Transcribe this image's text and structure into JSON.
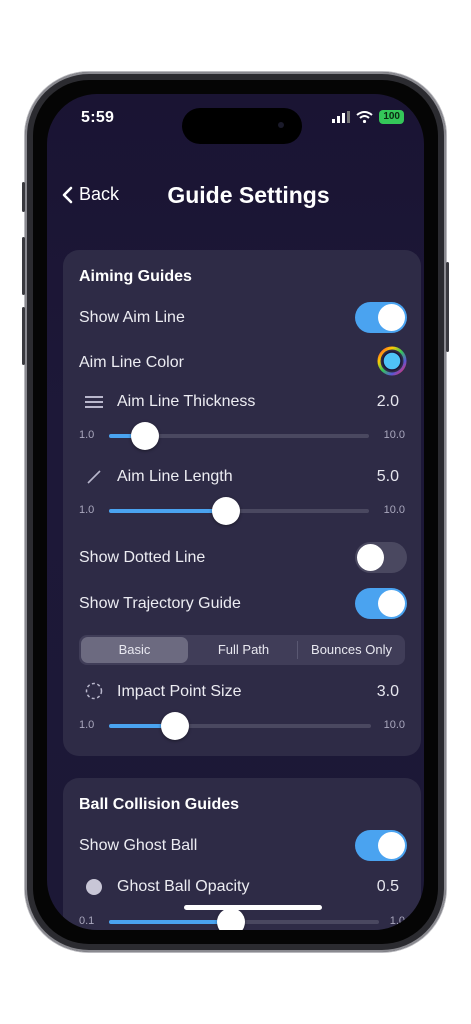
{
  "status": {
    "time": "5:59",
    "battery": "100"
  },
  "nav": {
    "back_label": "Back",
    "title": "Guide Settings"
  },
  "aiming": {
    "title": "Aiming Guides",
    "show_aim_line": {
      "label": "Show Aim Line",
      "on": true
    },
    "aim_line_color": {
      "label": "Aim Line Color",
      "swatch": "#4fc3f7"
    },
    "thickness": {
      "label": "Aim Line Thickness",
      "value": "2.0",
      "min": "1.0",
      "max": "10.0",
      "fraction": 0.14
    },
    "length": {
      "label": "Aim Line Length",
      "value": "5.0",
      "min": "1.0",
      "max": "10.0",
      "fraction": 0.45
    },
    "show_dotted_line": {
      "label": "Show Dotted Line",
      "on": false
    },
    "show_trajectory": {
      "label": "Show Trajectory Guide",
      "on": true
    },
    "segments": [
      "Basic",
      "Full Path",
      "Bounces Only"
    ],
    "impact_size": {
      "label": "Impact Point Size",
      "value": "3.0",
      "min": "1.0",
      "max": "10.0",
      "fraction": 0.25
    }
  },
  "collision": {
    "title": "Ball Collision Guides",
    "show_ghost_ball": {
      "label": "Show Ghost Ball",
      "on": true
    },
    "ghost_opacity": {
      "label": "Ghost Ball Opacity",
      "value": "0.5",
      "min": "0.1",
      "max": "1.0",
      "fraction": 0.45
    }
  },
  "colors": {
    "accent": "#4aa3f0",
    "card": "#2e2b46",
    "background": "#1b1636"
  }
}
